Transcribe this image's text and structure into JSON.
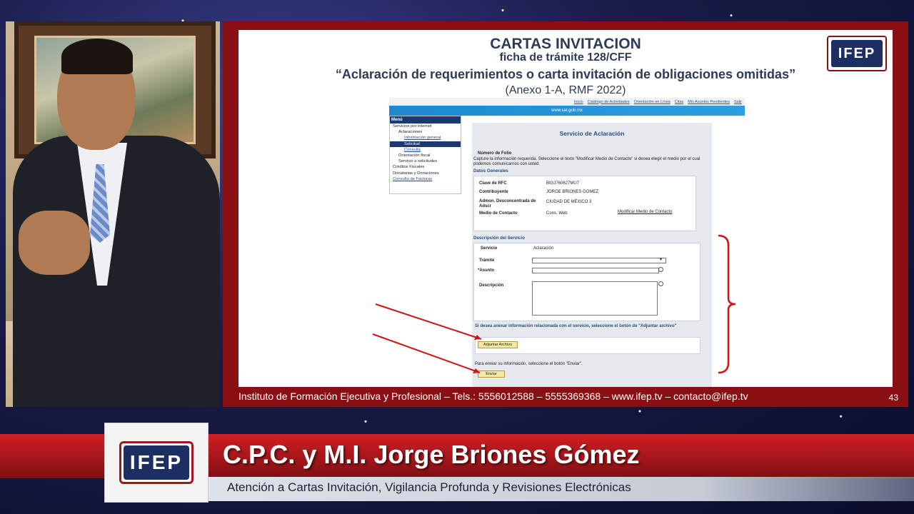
{
  "slide": {
    "title": "CARTAS INVITACION",
    "subtitle": "ficha de trámite 128/CFF",
    "heading": "“Aclaración de requerimientos o carta invitación de obligaciones omitidas”",
    "reference": "(Anexo 1-A, RMF 2022)",
    "logo_text": "IFEP",
    "footer": "Instituto de Formación Ejecutiva y Profesional  –  Tels.: 5556012588  –  5555369368  –  www.ifep.tv  –  contacto@ifep.tv",
    "page_number": "43"
  },
  "web": {
    "topnav": [
      "Inicio",
      "Catálogo de Actividades",
      "Orientación en Línea",
      "Citas",
      "Mis Asuntos Pendientes",
      "Salir"
    ],
    "banner": "www.sat.gob.mx",
    "menu": {
      "header": "Menú",
      "items": [
        {
          "label": "Servicios por internet",
          "level": 0
        },
        {
          "label": "Aclaraciones",
          "level": 1
        },
        {
          "label": "Información general",
          "level": 2
        },
        {
          "label": "Solicitud",
          "level": 2,
          "active": true
        },
        {
          "label": "Consulta",
          "level": 2
        },
        {
          "label": "Orientación fiscal",
          "level": 1
        },
        {
          "label": "Servicio o solicitudes",
          "level": 1
        },
        {
          "label": "Créditos Fiscales",
          "level": 0
        },
        {
          "label": "Donatarias y Donaciones",
          "level": 0
        },
        {
          "label": "Consulta de Facturas",
          "level": 0
        }
      ]
    },
    "form": {
      "title": "Servicio de Aclaración",
      "folio_label": "Número de Folio",
      "instructions": "Capture la información requerida. Seleccione el texto \"Modificar Medio de Contacto\" si desea elegir el medio por el cual podemos comunicarnos con usted.",
      "datos_generales": "Datos Generales",
      "rfc_label": "Clave de RFC",
      "rfc_value": "BIGJ760627MU7",
      "contribuyente_label": "Contribuyente",
      "contribuyente_value": "JORGE BRIONES GOMEZ",
      "admon_label": "Admon. Desconcentrada de Adscr",
      "admon_value": "CIUDAD DE MÉXICO 3",
      "medio_label": "Medio de Contacto",
      "medio_value": "Cons. Web",
      "modificar_link": "Modificar Medio de Contacto",
      "descripcion_servicio": "Descripción del Servicio",
      "servicio_label": "Servicio",
      "servicio_value": "Aclaración",
      "tramite_label": "Trámite",
      "asunto_label": "*Asunto",
      "descripcion_label": "Descripción",
      "anexar_text": "Si desea anexar información relacionada con el servicio, seleccione el botón de \"Adjuntar archivo\"",
      "adjuntar_button": "Adjuntar Archivo",
      "enviar_text": "Para enviar su información, seleccione el botón \"Enviar\".",
      "enviar_button": "Enviar"
    }
  },
  "lower_third": {
    "logo_text": "IFEP",
    "name": "C.P.C. y M.I. Jorge Briones Gómez",
    "description": "Atención a Cartas Invitación, Vigilancia Profunda y Revisiones Electrónicas"
  },
  "colors": {
    "slide_frame": "#8a0f12",
    "title_navy": "#2e3b57",
    "band_red": "#c01b20",
    "annotation_red": "#d01515"
  }
}
